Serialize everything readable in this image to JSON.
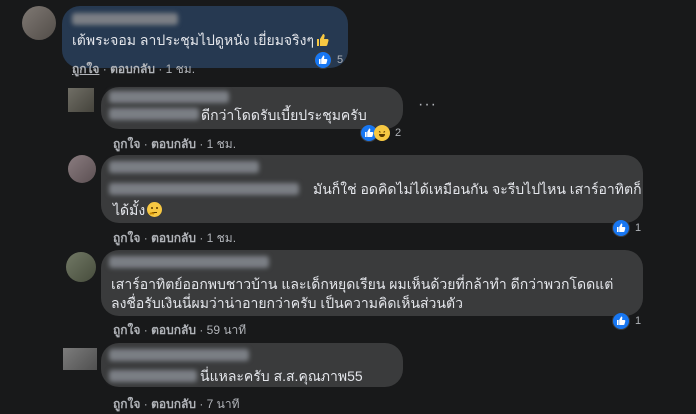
{
  "comments": [
    {
      "text": "เต้พระจอม ลาประชุมไปดูหนัง เยี่ยมจริงๆ",
      "reaction_count": "5",
      "like_label": "ถูกใจ",
      "reply_label": "ตอบกลับ",
      "time": "1 ชม."
    },
    {
      "text": "ดีกว่าโดดรับเบี้ยประชุมครับ",
      "reaction_count": "2",
      "like_label": "ถูกใจ",
      "reply_label": "ตอบกลับ",
      "time": "1 ชม."
    },
    {
      "text_line1": "มันก็ใช่ อดคิดไม่ได้เหมือนกัน จะรีบไปไหน เสาร์อาทิตก็",
      "text_line2": "ได้มั้ง",
      "reaction_count": "1",
      "like_label": "ถูกใจ",
      "reply_label": "ตอบกลับ",
      "time": "1 ชม."
    },
    {
      "text_line1": "เสาร์อาทิตย์ออกพบชาวบ้าน และเด็กหยุดเรียน ผมเห็นด้วยที่กล้าทำ ดีกว่าพวกโดดแต่",
      "text_line2": "ลงชื่อรับเงินนี่ผมว่าน่าอายกว่าครับ เป็นความคิดเห็นส่วนตัว",
      "reaction_count": "1",
      "like_label": "ถูกใจ",
      "reply_label": "ตอบกลับ",
      "time": "59 นาที"
    },
    {
      "text": "นี่แหละครับ ส.ส.คุณภาพ55",
      "like_label": "ถูกใจ",
      "reply_label": "ตอบกลับ",
      "time": "7 นาที"
    }
  ],
  "separator": "·",
  "more_options": "···"
}
